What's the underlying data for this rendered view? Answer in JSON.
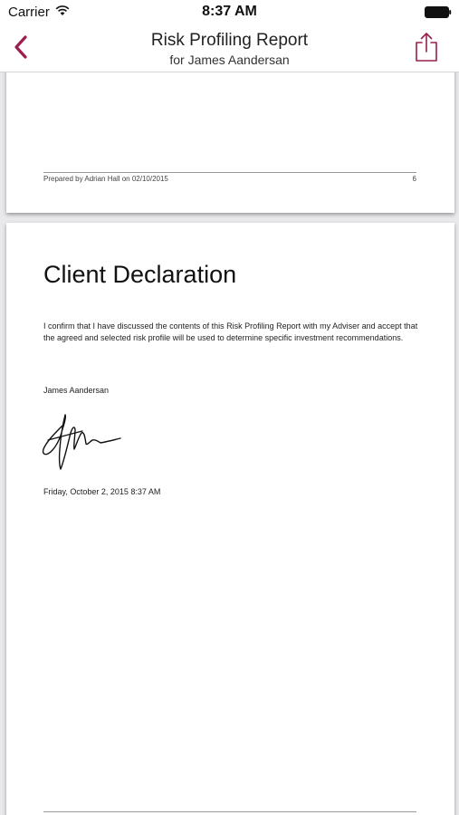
{
  "status_bar": {
    "carrier": "Carrier",
    "time": "8:37 AM"
  },
  "nav": {
    "title": "Risk Profiling Report",
    "subtitle": "for James Aandersan",
    "back_icon": "chevron-left-icon",
    "share_icon": "share-icon",
    "accent_color": "#9b1e4f"
  },
  "document": {
    "previous_page": {
      "footer_text": "Prepared by Adrian Hall on 02/10/2015",
      "page_number": "6"
    },
    "current_page": {
      "heading": "Client Declaration",
      "body": "I confirm that I have discussed the contents of this Risk Profiling Report with my Adviser and accept that the agreed and selected risk profile will be used to determine specific investment recommendations.",
      "signer_name": "James Aandersan",
      "signed_date": "Friday, October 2, 2015 8:37 AM"
    }
  }
}
